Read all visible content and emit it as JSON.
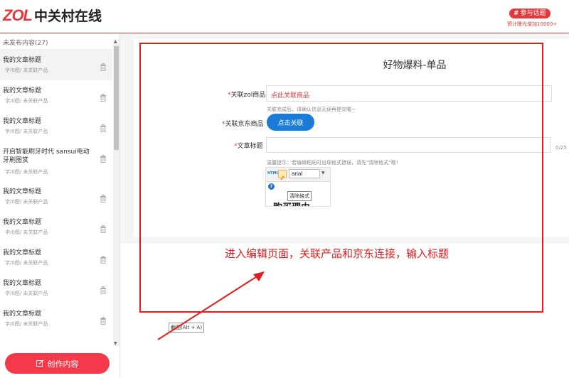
{
  "header": {
    "logo_mark": "ZOL",
    "logo_text": "中关村在线",
    "topic_button": "参与话题",
    "topic_subtext": "预计曝光增加10000+"
  },
  "sidebar": {
    "unpublished_label": "未发布内容(27)",
    "items": [
      {
        "title": "我的文章标题",
        "meta": "字/0图/ 未关联产品"
      },
      {
        "title": "我的文章标题",
        "meta": "字/0图/ 未关联产品"
      },
      {
        "title": "我的文章标题",
        "meta": "字/0图/ 未关联产品"
      },
      {
        "title": "开启智能刷牙时代 sansui电动牙刷图赏",
        "meta": "字/0图/ 未关联产品"
      },
      {
        "title": "我的文章标题",
        "meta": "字/0图/ 未关联产品"
      },
      {
        "title": "我的文章标题",
        "meta": "字/0图/ 未关联产品"
      },
      {
        "title": "我的文章标题",
        "meta": "字/0图/ 未关联产品"
      },
      {
        "title": "我的文章标题",
        "meta": "字/0图/ 未关联产品"
      },
      {
        "title": "我的文章标题",
        "meta": "字/0图/ 未关联产品"
      }
    ],
    "create_button": "创作内容"
  },
  "form": {
    "page_title": "好物爆料-单品",
    "zol_label": "关联zol商品",
    "zol_placeholder": "点此关联商品",
    "zol_hint": "关联完成后，请确认信息无误再提交喔~",
    "jd_label": "关联京东商品",
    "jd_button": "点击关联",
    "title_label": "文章标题",
    "title_counter": "0/25",
    "paste_hint": "温馨提示：若编辑粘贴时出现格式错误，请先\"清除格式\"哦！",
    "required_mark": "*"
  },
  "editor": {
    "html_button": "HTML",
    "font_value": "arial",
    "help_icon": "?",
    "tooltip": "清除格式",
    "body_text": "购买理由"
  },
  "annotation": {
    "text": "进入编辑页面，关联产品和京东连接，输入标题",
    "shortcut_tip": "截图(Alt + A)",
    "color": "#e41c1c"
  },
  "colors": {
    "brand_red": "#e4393c",
    "jd_blue": "#1b7bd6",
    "create_button": "#f4394a"
  },
  "icons": [
    "trash-icon",
    "edit-icon",
    "eraser-icon",
    "help-icon",
    "hash-icon"
  ]
}
